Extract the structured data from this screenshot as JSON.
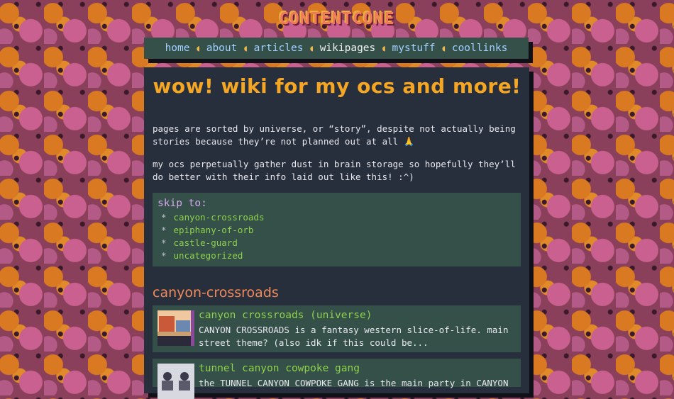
{
  "site": {
    "logo_text": "CONTENTCONE"
  },
  "nav": {
    "items": [
      {
        "label": "home"
      },
      {
        "label": "about"
      },
      {
        "label": "articles"
      },
      {
        "label": "wikipages"
      },
      {
        "label": "mystuff"
      },
      {
        "label": "coollinks"
      }
    ],
    "current": "wikipages"
  },
  "page": {
    "title": "wow! wiki for my ocs and more!",
    "intro": [
      "pages are sorted by universe, or “story”, despite not actually being stories because they’re not planned out at all 🙏",
      "my ocs perpetually gather dust in brain storage so hopefully they’ll do better with their info laid out like this! :^)"
    ]
  },
  "skip": {
    "title": "skip to:",
    "items": [
      "canyon-crossroads",
      "epiphany-of-orb",
      "castle-guard",
      "uncategorized"
    ]
  },
  "sections": [
    {
      "heading": "canyon-crossroads",
      "cards": [
        {
          "title": "canyon crossroads (universe)",
          "description": "CANYON CROSSROADS is a fantasy western slice-of-life. main street theme? (also idk if this could be..."
        },
        {
          "title": "tunnel canyon cowpoke gang",
          "description": "the TUNNEL CANYON COWPOKE GANG is the main party in CANYON"
        }
      ]
    }
  ],
  "colors": {
    "accent": "#f5a623",
    "panel": "#272f3d",
    "card": "#355049",
    "link": "#8ed14a"
  }
}
